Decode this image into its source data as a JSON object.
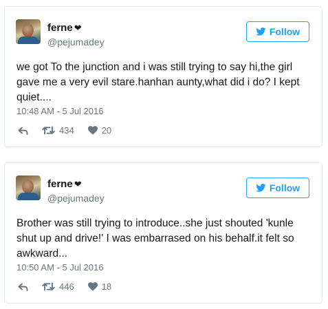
{
  "colors": {
    "accent": "#1da1f2",
    "muted": "#657786",
    "border": "#e1e8ed",
    "text": "#14171a"
  },
  "icons": {
    "reply": "reply-icon",
    "retweet": "retweet-icon",
    "like": "heart-icon",
    "follow": "twitter-bird-icon",
    "emoji": "black-heart-icon"
  },
  "tweets": [
    {
      "display_name": "ferne",
      "name_emoji": "❤",
      "handle": "@pejumadey",
      "follow_label": "Follow",
      "text": "we got To the junction and i was still trying to say hi,the girl gave me a very evil stare.hanhan aunty,what did i do? I kept quiet....",
      "timestamp": "10:48 AM - 5 Jul 2016",
      "retweets": "434",
      "likes": "20"
    },
    {
      "display_name": "ferne",
      "name_emoji": "❤",
      "handle": "@pejumadey",
      "follow_label": "Follow",
      "text": "Brother was still trying to introduce..she just shouted 'kunle shut up and drive!' I was embarrased on his behalf.it felt so awkward...",
      "timestamp": "10:50 AM - 5 Jul 2016",
      "retweets": "446",
      "likes": "18"
    }
  ]
}
